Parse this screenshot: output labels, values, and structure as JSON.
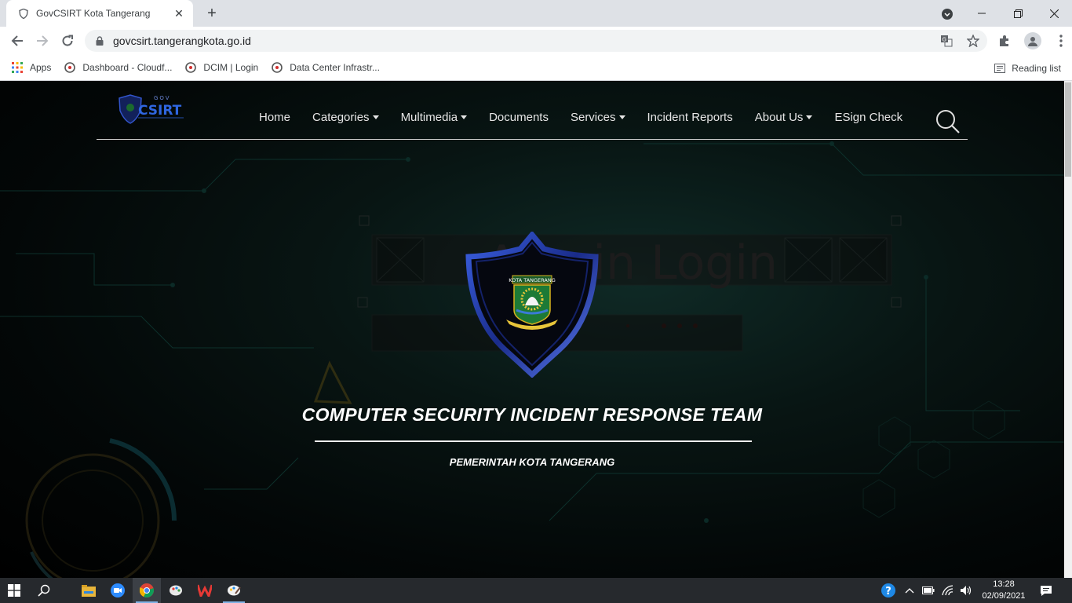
{
  "browser": {
    "tab": {
      "title": "GovCSIRT Kota Tangerang"
    },
    "address": {
      "url": "govcsirt.tangerangkota.go.id"
    },
    "bookmarks": [
      {
        "label": "Apps",
        "icon": "apps-grid-icon"
      },
      {
        "label": "Dashboard - Cloudf...",
        "icon": "site-favicon-icon"
      },
      {
        "label": "DCIM | Login",
        "icon": "site-favicon-icon"
      },
      {
        "label": "Data Center Infrastr...",
        "icon": "site-favicon-icon"
      }
    ],
    "reading_list": "Reading list"
  },
  "site": {
    "logo": {
      "small": "GOV",
      "text": "CSIRT"
    },
    "nav": [
      {
        "label": "Home",
        "dropdown": false
      },
      {
        "label": "Categories",
        "dropdown": true
      },
      {
        "label": "Multimedia",
        "dropdown": true
      },
      {
        "label": "Documents",
        "dropdown": false
      },
      {
        "label": "Services",
        "dropdown": true
      },
      {
        "label": "Incident Reports",
        "dropdown": false
      },
      {
        "label": "About Us",
        "dropdown": true
      },
      {
        "label": "ESign Check",
        "dropdown": false
      }
    ],
    "background_text": "Admin Login",
    "emblem_label": "KOTA TANGERANG",
    "hero": {
      "title": "COMPUTER SECURITY INCIDENT RESPONSE TEAM",
      "subtitle": "PEMERINTAH KOTA TANGERANG"
    }
  },
  "taskbar": {
    "time": "13:28",
    "date": "02/09/2021"
  },
  "colors": {
    "accent_blue": "#1f3ea8",
    "page_bg": "#030707",
    "taskbar": "#26292d"
  }
}
